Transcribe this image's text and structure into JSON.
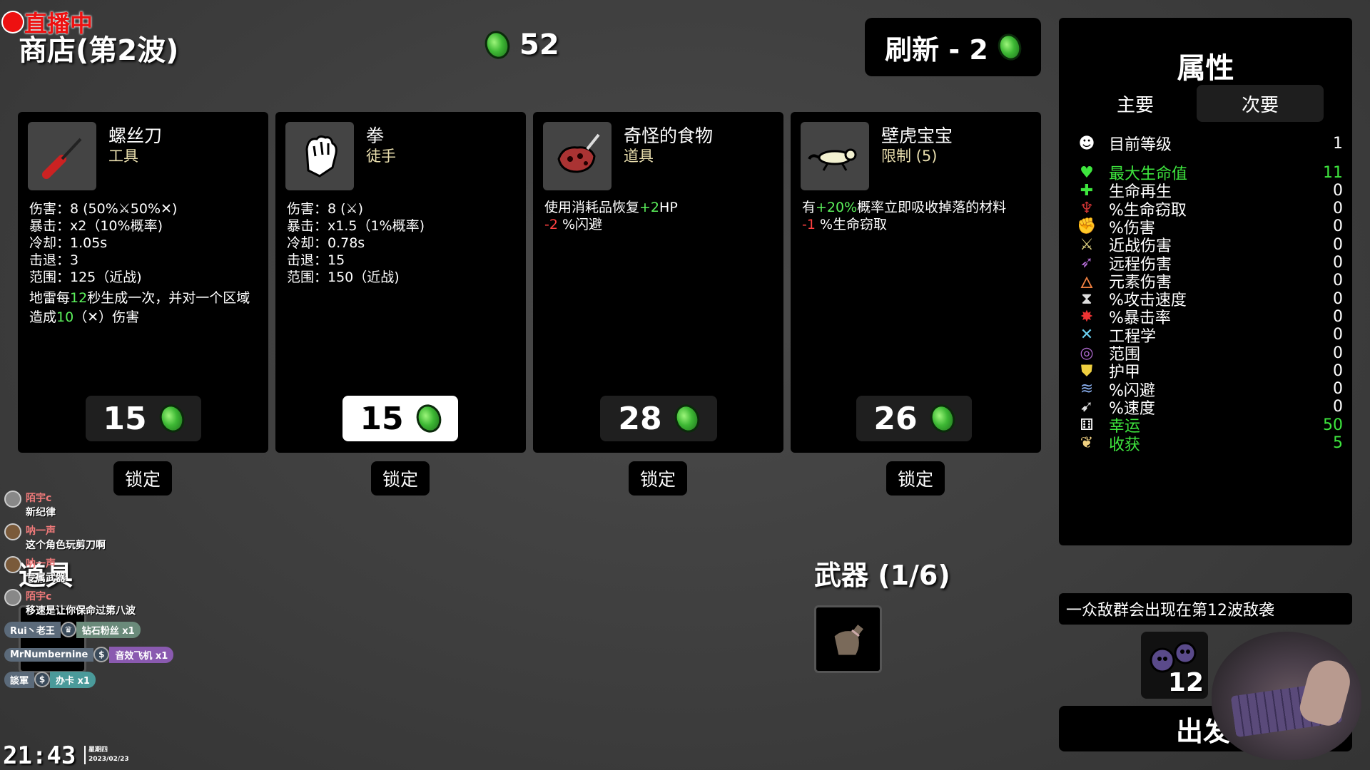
{
  "stream": {
    "live_label": "直播中",
    "clock": "21:43",
    "weekday": "星期四",
    "date": "2023/02/23"
  },
  "shop": {
    "title": "商店(第2波)",
    "materials": "52",
    "reroll_label": "刷新 - 2"
  },
  "cards": [
    {
      "name": "螺丝刀",
      "type": "工具",
      "icon": "screwdriver-icon",
      "price": "15",
      "lock": "锁定",
      "stats": [
        "伤害：8 (50%⚔50%✕)",
        "暴击：x2（10%概率)",
        "冷却：1.05s",
        "击退：3",
        "范围：125（近战)"
      ],
      "desc_parts": [
        "地雷每",
        "12",
        "秒生成一次，并对一个区域",
        "造成",
        "10",
        "（✕）伤害"
      ]
    },
    {
      "name": "拳",
      "type": "徒手",
      "icon": "fist-icon",
      "price": "15",
      "lock": "锁定",
      "selected": true,
      "stats": [
        "伤害：8 (⚔)",
        "暴击：x1.5（1%概率)",
        "冷却：0.78s",
        "击退：15",
        "范围：150（近战)"
      ]
    },
    {
      "name": "奇怪的食物",
      "type": "道具",
      "icon": "strange-food-icon",
      "price": "28",
      "lock": "锁定",
      "desc_parts": [
        "使用消耗品恢复",
        "+2",
        "HP",
        "-2",
        "%闪避"
      ]
    },
    {
      "name": "壁虎宝宝",
      "type": "限制 (5)",
      "icon": "baby-gecko-icon",
      "price": "26",
      "lock": "锁定",
      "desc_parts": [
        "有",
        "+20%",
        "概率立即吸收掉落的材料",
        "-1",
        "%生命窃取"
      ]
    }
  ],
  "stats_panel": {
    "title": "属性",
    "tab_primary": "主要",
    "tab_secondary": "次要",
    "rows": [
      {
        "name": "目前等级",
        "value": "1",
        "icon": "level-icon",
        "color": "#ffffff"
      },
      {
        "name": "最大生命值",
        "value": "11",
        "icon": "heart-icon",
        "color": "#3ee63e",
        "highlight": true
      },
      {
        "name": "生命再生",
        "value": "0",
        "icon": "regen-icon",
        "color": "#ffffff"
      },
      {
        "name": "%生命窃取",
        "value": "0",
        "icon": "lifesteal-icon",
        "color": "#ffffff"
      },
      {
        "name": "%伤害",
        "value": "0",
        "icon": "damage-icon",
        "color": "#ffffff"
      },
      {
        "name": "近战伤害",
        "value": "0",
        "icon": "melee-icon",
        "color": "#ffffff"
      },
      {
        "name": "远程伤害",
        "value": "0",
        "icon": "ranged-icon",
        "color": "#ffffff"
      },
      {
        "name": "元素伤害",
        "value": "0",
        "icon": "elemental-icon",
        "color": "#ffffff"
      },
      {
        "name": "%攻击速度",
        "value": "0",
        "icon": "attack-speed-icon",
        "color": "#ffffff"
      },
      {
        "name": "%暴击率",
        "value": "0",
        "icon": "crit-icon",
        "color": "#ffffff"
      },
      {
        "name": "工程学",
        "value": "0",
        "icon": "engineering-icon",
        "color": "#ffffff"
      },
      {
        "name": "范围",
        "value": "0",
        "icon": "range-icon",
        "color": "#ffffff"
      },
      {
        "name": "护甲",
        "value": "0",
        "icon": "armor-icon",
        "color": "#ffffff"
      },
      {
        "name": "%闪避",
        "value": "0",
        "icon": "dodge-icon",
        "color": "#ffffff"
      },
      {
        "name": "%速度",
        "value": "0",
        "icon": "speed-icon",
        "color": "#ffffff"
      },
      {
        "name": "幸运",
        "value": "50",
        "icon": "luck-icon",
        "color": "#3ee63e",
        "highlight": true
      },
      {
        "name": "收获",
        "value": "5",
        "icon": "harvest-icon",
        "color": "#3ee63e",
        "highlight": true
      }
    ]
  },
  "weapons": {
    "title": "武器 (1/6)"
  },
  "items": {
    "title": "道具"
  },
  "wave": {
    "banner": "一众敌群会出现在第12波敌袭",
    "enemy_count": "12",
    "go_label": "出发"
  },
  "chat": [
    {
      "user": "陌宇c",
      "text": "新纪律"
    },
    {
      "user": "呐一声",
      "text": "这个角色玩剪刀啊"
    },
    {
      "user": "呐一声",
      "text": "专属武器"
    },
    {
      "user": "陌宇c",
      "text": "移速是让你保命过第八波"
    }
  ],
  "gifts": [
    {
      "user": "Rui丶老王",
      "gift": "钻石粉丝 x1",
      "color": "#6a8a7a",
      "icon": "crown-icon"
    },
    {
      "user": "MrNumbernine",
      "gift": "音效飞机 x1",
      "color": "#8a5ab0",
      "icon": "dollar-icon"
    },
    {
      "user": "談軍",
      "gift": "办卡 x1",
      "color": "#4a9a9a",
      "icon": "dollar-icon"
    }
  ]
}
